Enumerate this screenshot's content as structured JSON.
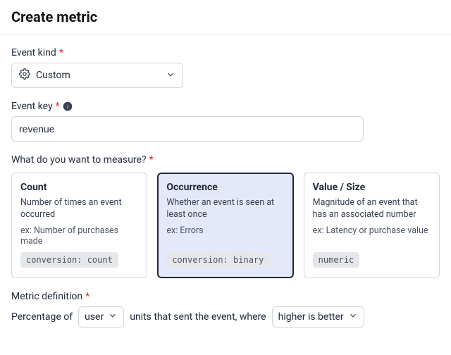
{
  "page_title": "Create metric",
  "event_kind": {
    "label": "Event kind",
    "value": "Custom"
  },
  "event_key": {
    "label": "Event key",
    "value": "revenue"
  },
  "measure": {
    "label": "What do you want to measure?",
    "cards": [
      {
        "title": "Count",
        "desc": "Number of times an event occurred",
        "example": "ex: Number of purchases made",
        "badge": "conversion: count",
        "selected": false
      },
      {
        "title": "Occurrence",
        "desc": "Whether an event is seen at least once",
        "example": "ex: Errors",
        "badge": "conversion: binary",
        "selected": true
      },
      {
        "title": "Value / Size",
        "desc": "Magnitude of an event that has an associated number",
        "example": "ex: Latency or purchase value",
        "badge": "numeric",
        "selected": false
      }
    ]
  },
  "definition": {
    "label": "Metric definition",
    "prefix": "Percentage of",
    "unit": "user",
    "middle": "units that sent the event, where",
    "direction": "higher is better"
  },
  "required_marker": "*"
}
